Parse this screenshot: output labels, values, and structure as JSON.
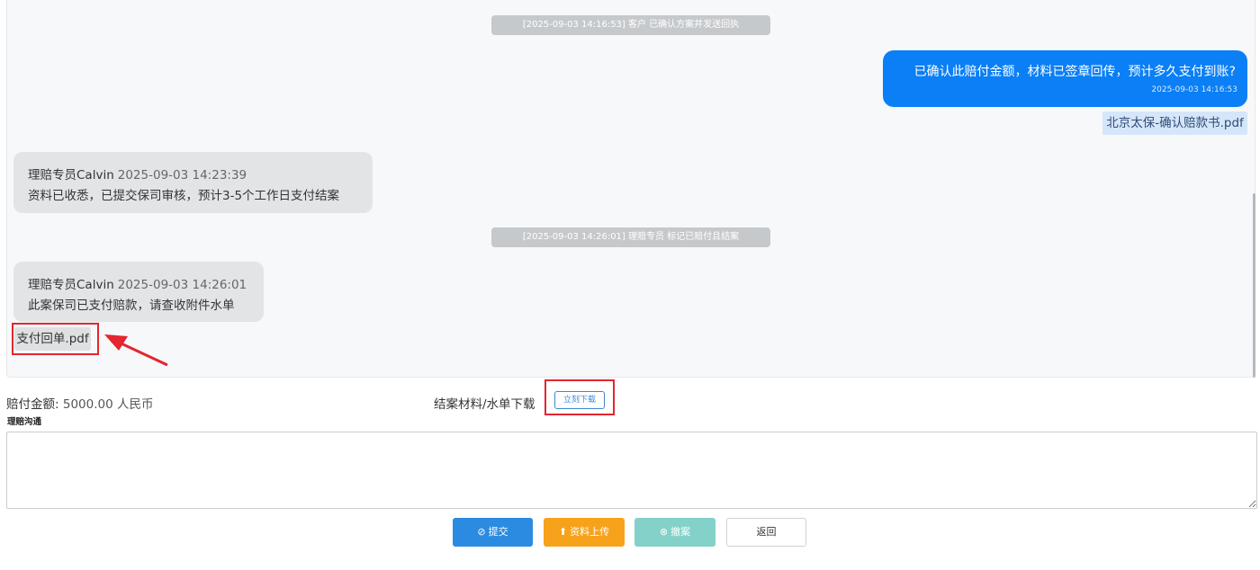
{
  "chat": {
    "system_messages": [
      "[2025-09-03 14:16:53] 客户 已确认方案并发送回执",
      "[2025-09-03 14:26:01] 理赔专员 标记已赔付且结案"
    ],
    "customer_message": {
      "text": "已确认此赔付金额，材料已签章回传，预计多久支付到账?",
      "time": "2025-09-03 14:16:53",
      "attachment": "北京太保-确认赔款书.pdf"
    },
    "agent_messages": [
      {
        "sender": "理赔专员Calvin",
        "time": "2025-09-03 14:23:39",
        "text": "资料已收悉，已提交保司审核，预计3-5个工作日支付结案"
      },
      {
        "sender": "理赔专员Calvin",
        "time": "2025-09-03 14:26:01",
        "text": "此案保司已支付赔款，请查收附件水单",
        "attachment": "支付回单.pdf"
      }
    ]
  },
  "info": {
    "amount_label": "赔付金额:",
    "amount_value": "5000.00 人民币",
    "download_label": "结案材料/水单下载",
    "download_button": "立刻下载"
  },
  "communication": {
    "label": "理赔沟通",
    "value": ""
  },
  "buttons": {
    "submit": "提交",
    "upload": "资料上传",
    "close_case": "撤案",
    "back": "返回"
  },
  "colors": {
    "primary": "#2b8be0",
    "warning": "#f7a21b",
    "success_disabled": "#83d1c8",
    "customer_bubble": "#0a7ff6",
    "highlight": "#e3262f"
  },
  "icons": {
    "submit": "check-circle-icon",
    "upload": "upload-icon",
    "close_case": "cancel-circle-icon"
  }
}
